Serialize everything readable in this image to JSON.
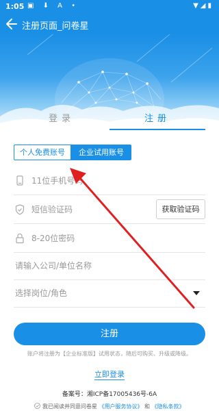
{
  "status_bar": {
    "time": "1:05",
    "left_icons": "▣ ⬇ A •",
    "right_icons": "▼◢▮"
  },
  "header": {
    "title": "注册页面_问卷星"
  },
  "tabs": {
    "login": "登录",
    "register": "注册",
    "active": "register"
  },
  "account_type": {
    "personal": "个人免费账号",
    "enterprise": "企业试用账号",
    "selected": "enterprise"
  },
  "form": {
    "phone_placeholder": "11位手机号码",
    "sms_placeholder": "短信验证码",
    "get_code_button": "获取验证码",
    "password_placeholder": "8-20位密码",
    "company_placeholder": "请输入公司/单位名称",
    "role_placeholder": "选择岗位/角色"
  },
  "register_button": "注册",
  "notice": "账户将注册为【企业标准版】试用状态，随后可购买、升级或降级。",
  "login_link": "立即登录",
  "icp": "备案号：湘ICP备17005436号-6A",
  "agreement": {
    "prefix": "我已阅读并同意问卷星",
    "user_agreement": "《用户服务协议》",
    "and": "和",
    "privacy": "《隐私条款》"
  },
  "colors": {
    "accent": "#1a8fe6",
    "annotation_arrow": "#e02020"
  },
  "icons": {
    "back": "back-arrow-icon",
    "phone": "phone-icon",
    "shield": "shield-icon",
    "lock": "lock-icon",
    "dropdown": "chevron-down-icon",
    "check": "check-circle-icon"
  }
}
